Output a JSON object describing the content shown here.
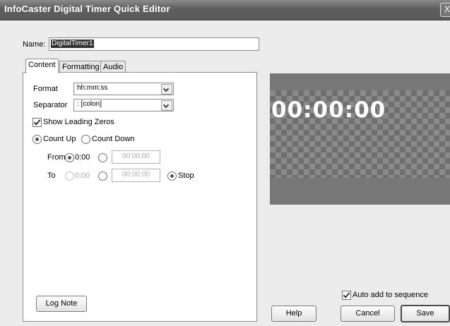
{
  "window": {
    "title": "InfoCaster Digital Timer Quick Editor",
    "close_glyph": "X"
  },
  "name_field": {
    "label": "Name:",
    "value": "DigitalTimer1"
  },
  "tabs": [
    {
      "label": "Content",
      "active": true
    },
    {
      "label": "Formatting",
      "active": false
    },
    {
      "label": "Audio",
      "active": false
    }
  ],
  "content": {
    "format": {
      "label": "Format",
      "value": "hh:mm:ss"
    },
    "separator": {
      "label": "Separator",
      "value": ": [colon]"
    },
    "show_leading_zeros": {
      "label": "Show Leading Zeros",
      "checked": true
    },
    "count_up": {
      "label": "Count Up",
      "selected": true
    },
    "count_down": {
      "label": "Count Down",
      "selected": false
    },
    "from": {
      "label": "From",
      "preset": "0:00",
      "time": "00:00:00"
    },
    "to": {
      "label": "To",
      "preset": "0:00",
      "time": "00:00:00",
      "stop": "Stop"
    }
  },
  "preview": {
    "timer_text": "00:00:00"
  },
  "auto_add": {
    "label": "Auto add to sequence",
    "checked": true
  },
  "buttons": {
    "log_note": "Log Note",
    "help": "Help",
    "cancel": "Cancel",
    "save": "Save"
  }
}
